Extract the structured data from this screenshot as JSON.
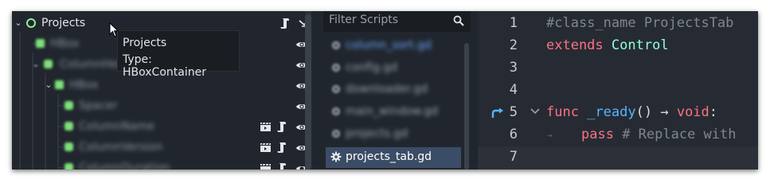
{
  "scene_tree": {
    "root": {
      "label": "Projects",
      "icon": "control-node-icon"
    },
    "rows": [
      {
        "label": "HBox",
        "icon": "hbox-container-icon",
        "blurred": true
      },
      {
        "label": "ColumnHeader",
        "icon": "control-node-icon",
        "blurred": true
      },
      {
        "label": "HBox",
        "icon": "hbox-container-icon",
        "blurred": true
      },
      {
        "label": "Spacer",
        "icon": "control-node-icon",
        "blurred": true
      },
      {
        "label": "ColumnName",
        "icon": "control-node-icon",
        "blurred": true
      },
      {
        "label": "ColumnVersion",
        "icon": "control-node-icon",
        "blurred": true
      },
      {
        "label": "ColumnDuration",
        "icon": "control-node-icon",
        "blurred": true
      }
    ]
  },
  "tooltip": {
    "name": "Projects",
    "type": "Type: HBoxContainer"
  },
  "scripts": {
    "filter_placeholder": "Filter Scripts",
    "items": [
      {
        "name": "column_sort.gd",
        "blurred": true
      },
      {
        "name": "config.gd",
        "blurred": true
      },
      {
        "name": "downloader.gd",
        "blurred": true
      },
      {
        "name": "main_window.gd",
        "blurred": true
      },
      {
        "name": "projects.gd",
        "blurred": true
      },
      {
        "name": "projects_tab.gd",
        "blurred": false,
        "selected": true
      }
    ]
  },
  "editor": {
    "lines": [
      {
        "num": "1",
        "comment": "#class_name ProjectsTab"
      },
      {
        "num": "2",
        "kw": "extends",
        "type": "Control"
      },
      {
        "num": "3"
      },
      {
        "num": "4"
      },
      {
        "num": "5",
        "kw": "func",
        "func": "_ready",
        "rest": "() →",
        "kw2": "void",
        "tail": ":"
      },
      {
        "num": "6",
        "kw": "pass",
        "comment": "# Replace with"
      },
      {
        "num": "7"
      }
    ]
  },
  "colors": {
    "background": "#21262e",
    "keyword": "#ff7085",
    "type": "#8effda",
    "function": "#57b3ff",
    "comment": "#80868e",
    "node_green": "#8eef97",
    "selection": "#3b4d66"
  }
}
